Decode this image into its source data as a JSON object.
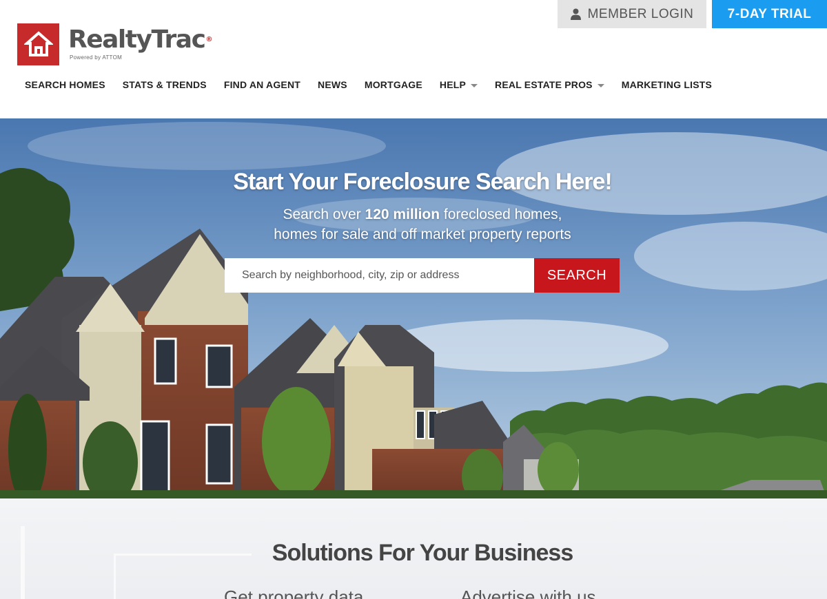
{
  "header": {
    "member_login_label": "MEMBER LOGIN",
    "trial_label": "7-DAY TRIAL",
    "logo_text": "RealtyTrac",
    "logo_tm": "®",
    "logo_sub": "Powered by ATTOM"
  },
  "nav": {
    "items": [
      {
        "label": "SEARCH HOMES"
      },
      {
        "label": "STATS & TRENDS"
      },
      {
        "label": "FIND AN AGENT"
      },
      {
        "label": "NEWS"
      },
      {
        "label": "MORTGAGE"
      },
      {
        "label": "HELP"
      },
      {
        "label": "REAL ESTATE PROS"
      },
      {
        "label": "MARKETING LISTS"
      }
    ]
  },
  "hero": {
    "title": "Start Your Foreclosure Search Here!",
    "sub_prefix": "Search over ",
    "sub_bold": "120 million",
    "sub_suffix": " foreclosed homes,",
    "sub_line2": "homes for sale and off market property reports",
    "search_placeholder": "Search by neighborhood, city, zip or address",
    "search_button": "SEARCH"
  },
  "solutions": {
    "title": "Solutions For Your Business",
    "link_left": "Get property data",
    "link_right": "Advertise with us"
  },
  "colors": {
    "brand_red": "#c62a2a",
    "trial_blue": "#1a9cf0",
    "search_red": "#c8161d"
  }
}
